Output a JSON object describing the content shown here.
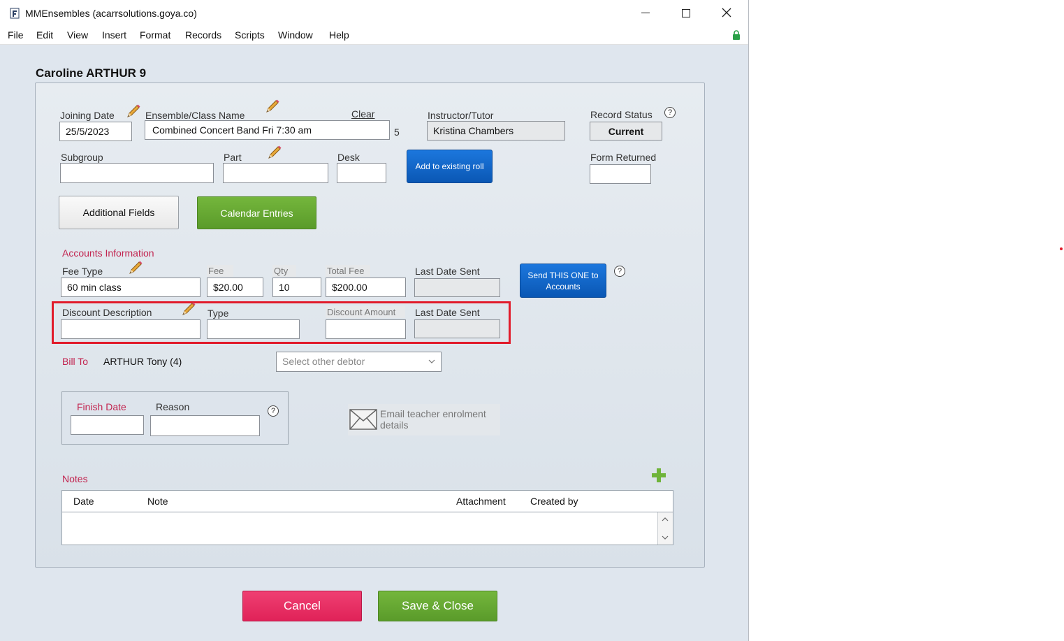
{
  "window": {
    "title": "MMEnsembles (acarrsolutions.goya.co)"
  },
  "menu": [
    "File",
    "Edit",
    "View",
    "Insert",
    "Format",
    "Records",
    "Scripts",
    "Window",
    "Help"
  ],
  "record": {
    "title": "Caroline ARTHUR 9",
    "joining_date_label": "Joining Date",
    "joining_date": "25/5/2023",
    "ensemble_label": "Ensemble/Class Name",
    "ensemble_clear": "Clear",
    "ensemble_value": "Combined Concert Band Fri 7:30 am",
    "ensemble_count": "5",
    "instructor_label": "Instructor/Tutor",
    "instructor_value": "Kristina Chambers",
    "record_status_label": "Record Status",
    "record_status_value": "Current",
    "subgroup_label": "Subgroup",
    "part_label": "Part",
    "desk_label": "Desk",
    "add_roll_button": "Add to existing roll",
    "form_returned_label": "Form Returned",
    "additional_fields_button": "Additional Fields",
    "calendar_entries_button": "Calendar Entries"
  },
  "accounts": {
    "section_label": "Accounts Information",
    "fee_type_label": "Fee Type",
    "fee_type_value": "60 min class",
    "fee_label": "Fee",
    "fee_value": "$20.00",
    "qty_label": "Qty",
    "qty_value": "10",
    "total_fee_label": "Total Fee",
    "total_fee_value": "$200.00",
    "last_date_sent_label": "Last Date Sent",
    "send_button": "Send THIS ONE to Accounts",
    "discount_desc_label": "Discount Description",
    "discount_type_label": "Type",
    "discount_amount_label": "Discount Amount",
    "discount_last_date_label": "Last Date Sent",
    "bill_to_label": "Bill To",
    "bill_to_value": "ARTHUR Tony (4)",
    "debtor_select": "Select other debtor"
  },
  "finish": {
    "finish_date_label": "Finish Date",
    "reason_label": "Reason"
  },
  "email": {
    "label": "Email teacher enrolment details"
  },
  "notes": {
    "section_label": "Notes",
    "columns": [
      "Date",
      "Note",
      "Attachment",
      "Created by"
    ]
  },
  "footer": {
    "cancel": "Cancel",
    "save": "Save & Close"
  },
  "colors": {
    "highlight": "#e11b2b",
    "blue_button": "#0b63c9",
    "green_button": "#65a830",
    "pink_button": "#ea2d63"
  }
}
